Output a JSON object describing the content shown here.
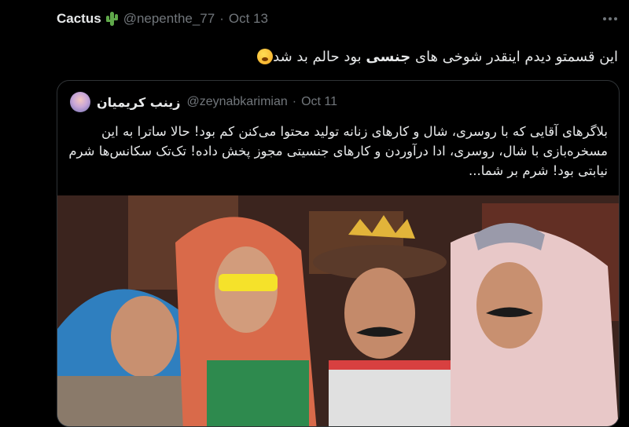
{
  "tweet": {
    "author_name": "Cactus",
    "author_icon": "cactus-emoji-icon",
    "handle": "@nepenthe_77",
    "separator": "·",
    "date": "Oct 13",
    "text_pre": "این قسمتو دیدم اینقدر شوخی های ",
    "text_bold": "جنسی",
    "text_post": " بود حالم بد شد",
    "emoji": "yawning-face-emoji-icon"
  },
  "quote": {
    "author_name": "زینب کریمیان",
    "handle": "@zeynabkarimian",
    "separator": "·",
    "date": "Oct 11",
    "text": "بلاگرهای آقایی که با روسری، شال و کارهای زنانه تولید محتوا می‌کنن کم بود! حالا ساترا به این مسخره‌بازی با شال، روسری، ادا درآوردن و  کارهای جنسیتی مجوز پخش داده! تک‌تک سکانس‌ها شرم نیابتی بود! شرم بر شما..."
  },
  "colors": {
    "background": "#000000",
    "text_primary": "#e7e9ea",
    "text_secondary": "#71767b",
    "border": "#2f3336"
  }
}
